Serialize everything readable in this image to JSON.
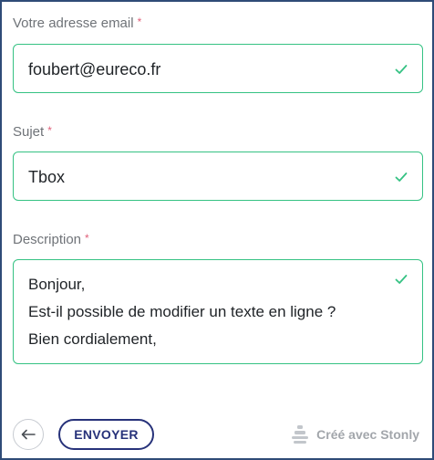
{
  "form": {
    "required_marker": "*",
    "email": {
      "label": "Votre adresse email",
      "value": "foubert@eureco.fr",
      "status": "valid"
    },
    "subject": {
      "label": "Sujet",
      "value": "Tbox",
      "status": "valid"
    },
    "description": {
      "label": "Description",
      "lines": [
        "Bonjour,",
        "Est-il possible de modifier un texte en ligne ?",
        "Bien cordialement,"
      ],
      "status": "valid"
    }
  },
  "footer": {
    "back_icon": "arrow-left-icon",
    "send_label": "ENVOYER",
    "brand_text": "Créé avec Stonly",
    "brand_icon": "stonly-logo-icon"
  },
  "colors": {
    "valid_border": "#35c283",
    "required": "#e0607a",
    "button": "#27327a",
    "frame": "#2f4b77"
  }
}
